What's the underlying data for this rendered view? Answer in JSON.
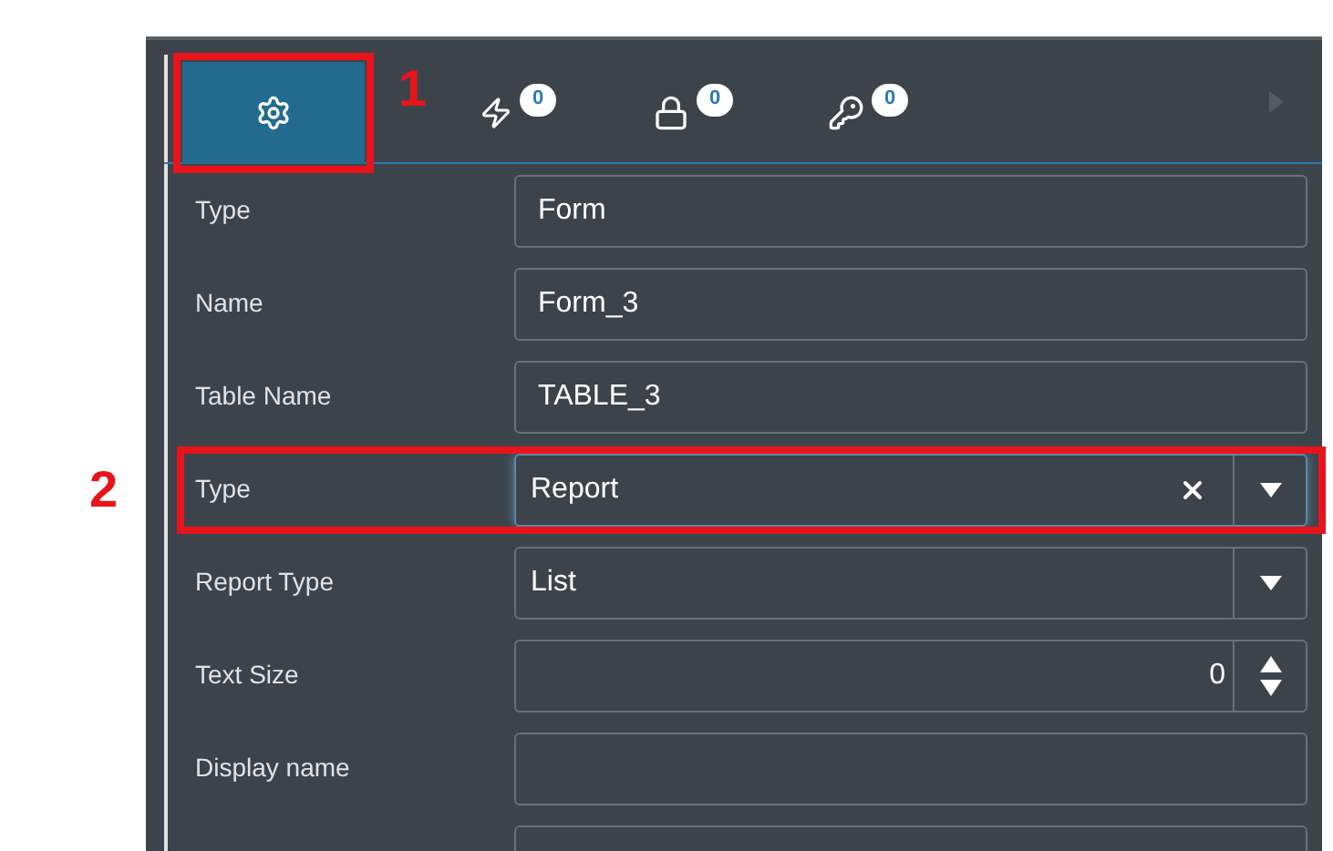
{
  "tabs": [
    {
      "kind": "settings",
      "selected": true,
      "annotation": "1"
    },
    {
      "kind": "events",
      "selected": false,
      "count": "0"
    },
    {
      "kind": "lock",
      "selected": false,
      "count": "0"
    },
    {
      "kind": "key",
      "selected": false,
      "count": "0"
    }
  ],
  "rows": [
    {
      "label": "Type",
      "kind": "text",
      "value": "Form"
    },
    {
      "label": "Name",
      "kind": "text",
      "value": "Form_3"
    },
    {
      "label": "Table Name",
      "kind": "text",
      "value": "TABLE_3"
    },
    {
      "label": "Type",
      "kind": "select",
      "value": "Report",
      "clearable": true,
      "focused": true,
      "annotation": "2"
    },
    {
      "label": "Report Type",
      "kind": "select",
      "value": "List",
      "clearable": false,
      "focused": false
    },
    {
      "label": "Text Size",
      "kind": "number",
      "value": "0"
    },
    {
      "label": "Display name",
      "kind": "text",
      "value": ""
    },
    {
      "kind": "text",
      "value": ""
    }
  ]
}
